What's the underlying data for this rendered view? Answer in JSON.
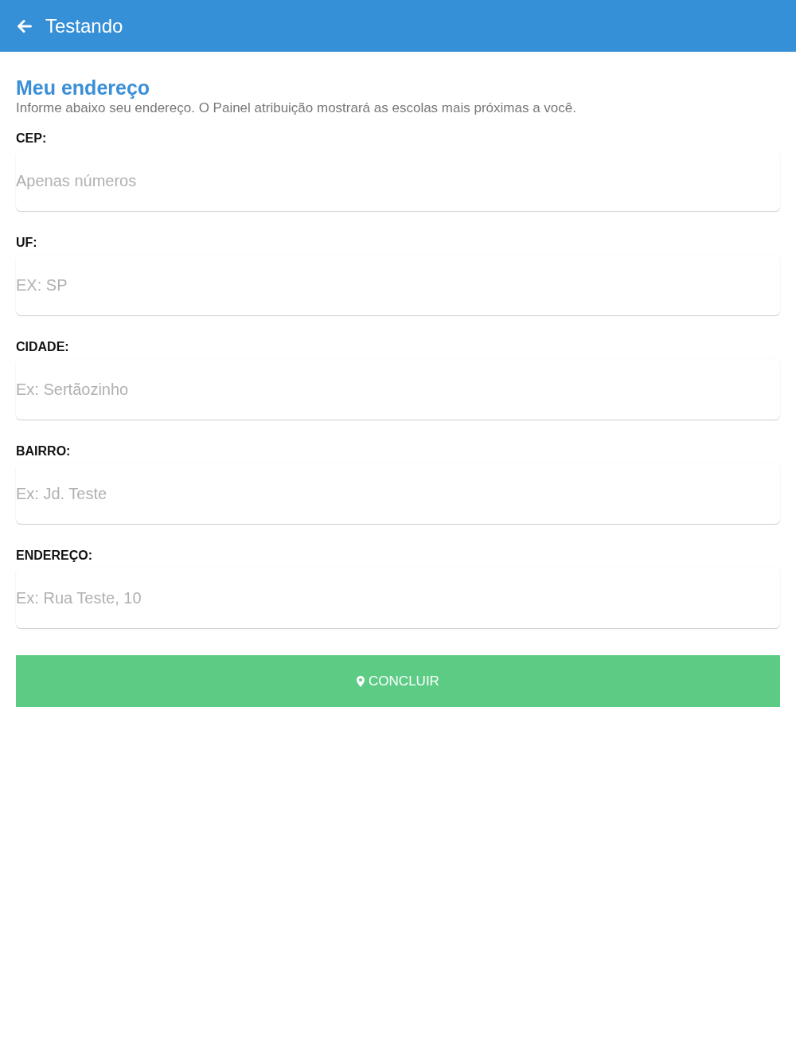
{
  "header": {
    "title": "Testando"
  },
  "section": {
    "title": "Meu endereço",
    "description": "Informe abaixo seu endereço. O Painel atribuição mostrará as escolas mais próximas a você."
  },
  "fields": [
    {
      "label": "CEP:",
      "placeholder": "Apenas números"
    },
    {
      "label": "UF:",
      "placeholder": "EX: SP"
    },
    {
      "label": "CIDADE:",
      "placeholder": "Ex: Sertãozinho"
    },
    {
      "label": "BAIRRO:",
      "placeholder": "Ex: Jd. Teste"
    },
    {
      "label": "ENDEREÇO:",
      "placeholder": "Ex: Rua Teste, 10"
    }
  ],
  "submit_button": {
    "label": "CONCLUIR"
  }
}
